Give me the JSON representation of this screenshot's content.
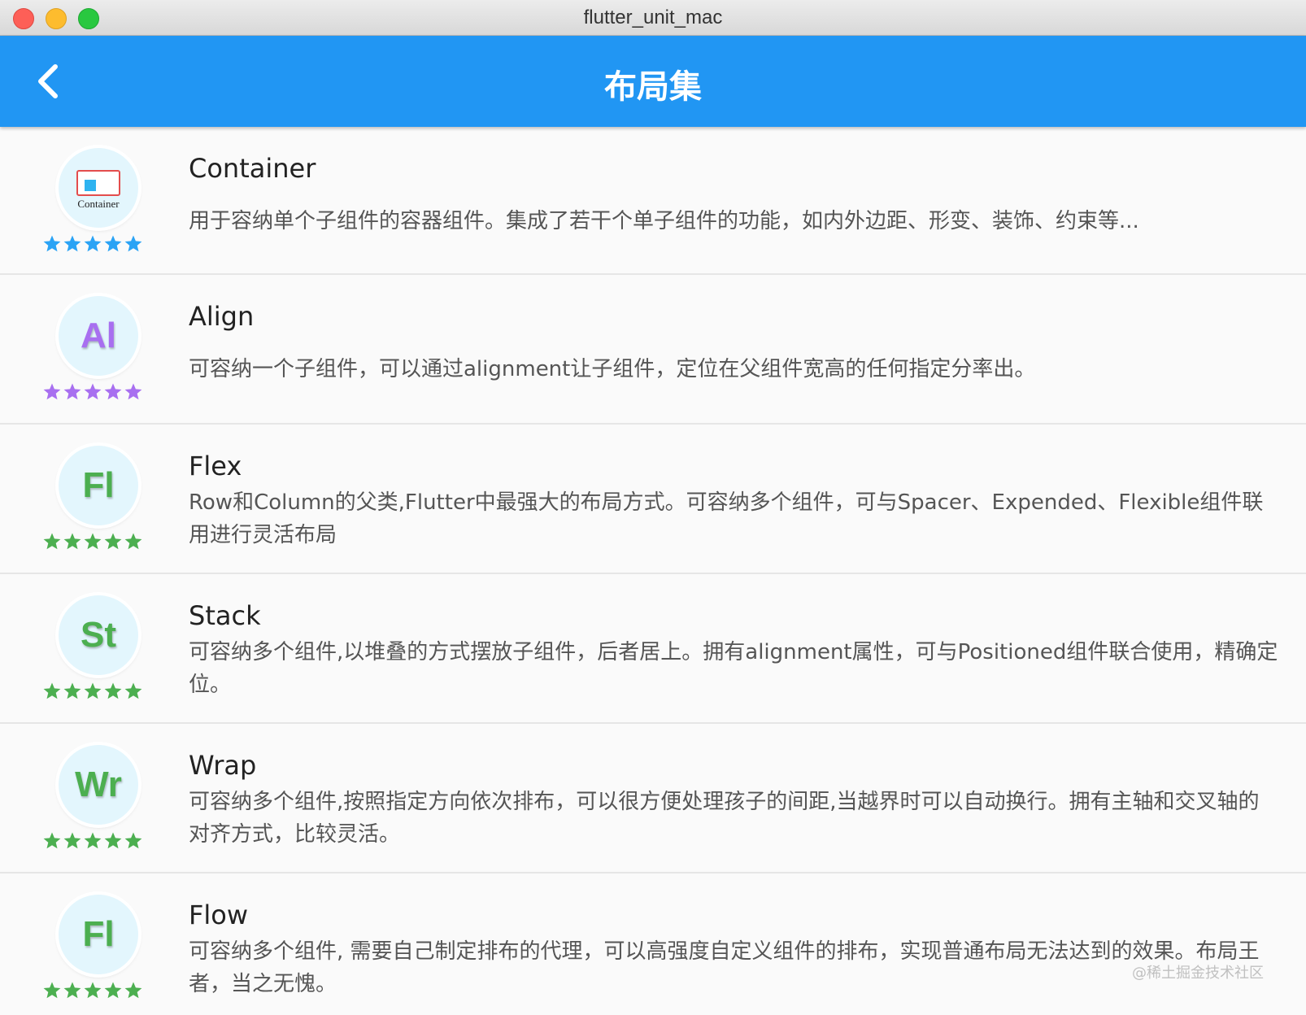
{
  "window": {
    "title": "flutter_unit_mac"
  },
  "appbar": {
    "title": "布局集"
  },
  "colors": {
    "appbar": "#2196f3",
    "star_blue": "#2aa3f5",
    "star_purple": "#a86ff0",
    "star_green": "#4caf50"
  },
  "items": [
    {
      "name": "Container",
      "icon_text": "Container",
      "star_color": "#2aa3f5",
      "rating": 5,
      "desc": "用于容纳单个子组件的容器组件。集成了若干个单子组件的功能，如内外边距、形变、装饰、约束等..."
    },
    {
      "name": "Align",
      "icon_text": "Al",
      "star_color": "#a86ff0",
      "rating": 5,
      "desc": "可容纳一个子组件，可以通过alignment让子组件，定位在父组件宽高的任何指定分率出。"
    },
    {
      "name": "Flex",
      "icon_text": "Fl",
      "star_color": "#4caf50",
      "rating": 5,
      "desc": "Row和Column的父类,Flutter中最强大的布局方式。可容纳多个组件，可与Spacer、Expended、Flexible组件联用进行灵活布局"
    },
    {
      "name": "Stack",
      "icon_text": "St",
      "star_color": "#4caf50",
      "rating": 5,
      "desc": "可容纳多个组件,以堆叠的方式摆放子组件，后者居上。拥有alignment属性，可与Positioned组件联合使用，精确定位。"
    },
    {
      "name": "Wrap",
      "icon_text": "Wr",
      "star_color": "#4caf50",
      "rating": 5,
      "desc": "可容纳多个组件,按照指定方向依次排布，可以很方便处理孩子的间距,当越界时可以自动换行。拥有主轴和交叉轴的对齐方式，比较灵活。"
    },
    {
      "name": "Flow",
      "icon_text": "Fl",
      "star_color": "#4caf50",
      "rating": 5,
      "desc": "可容纳多个组件, 需要自己制定排布的代理，可以高强度自定义组件的排布，实现普通布局无法达到的效果。布局王者，当之无愧。"
    }
  ],
  "watermark": "@稀土掘金技术社区"
}
